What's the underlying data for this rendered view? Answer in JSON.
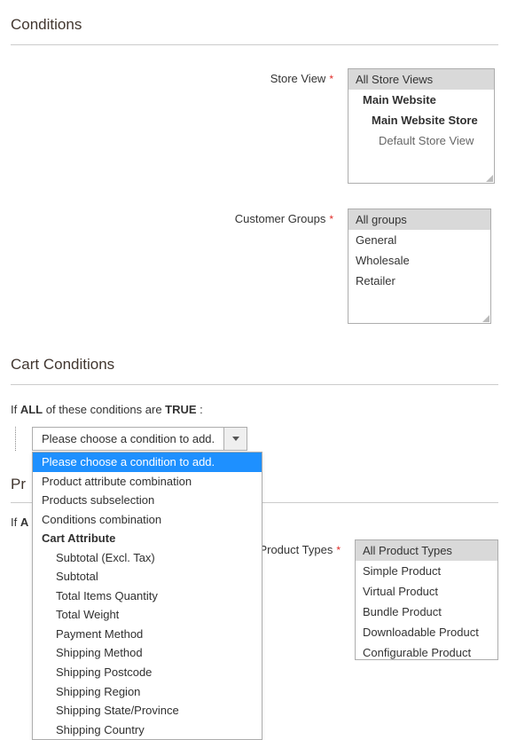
{
  "sections": {
    "conditions_title": "Conditions",
    "cart_conditions_title": "Cart Conditions",
    "product_section_prefix": "Pr",
    "truncated_if": "If A"
  },
  "fields": {
    "store_view": {
      "label": "Store View",
      "options": [
        {
          "text": "All Store Views",
          "level": 0,
          "selected": true
        },
        {
          "text": "Main Website",
          "level": 1,
          "selected": false
        },
        {
          "text": "Main Website Store",
          "level": 2,
          "selected": false
        },
        {
          "text": "Default Store View",
          "level": 3,
          "selected": false
        }
      ]
    },
    "customer_groups": {
      "label": "Customer Groups",
      "options": [
        {
          "text": "All groups",
          "selected": true
        },
        {
          "text": "General",
          "selected": false
        },
        {
          "text": "Wholesale",
          "selected": false
        },
        {
          "text": "Retailer",
          "selected": false
        }
      ]
    },
    "product_types": {
      "label": "Product Types",
      "options": [
        {
          "text": "All Product Types",
          "selected": true
        },
        {
          "text": "Simple Product",
          "selected": false
        },
        {
          "text": "Virtual Product",
          "selected": false
        },
        {
          "text": "Bundle Product",
          "selected": false
        },
        {
          "text": "Downloadable Product",
          "selected": false
        },
        {
          "text": "Configurable Product",
          "selected": false
        }
      ]
    }
  },
  "condition_sentence": {
    "prefix": "If ",
    "aggregator": "ALL",
    "mid": "  of these conditions are ",
    "value": "TRUE",
    "suffix": " :"
  },
  "condition_chooser": {
    "current": "Please choose a condition to add.",
    "options": [
      {
        "text": "Please choose a condition to add.",
        "highlighted": true
      },
      {
        "text": "Product attribute combination"
      },
      {
        "text": "Products subselection"
      },
      {
        "text": "Conditions combination"
      },
      {
        "text": "Cart Attribute",
        "group": true
      },
      {
        "text": "Subtotal (Excl. Tax)",
        "indent": true
      },
      {
        "text": "Subtotal",
        "indent": true
      },
      {
        "text": "Total Items Quantity",
        "indent": true
      },
      {
        "text": "Total Weight",
        "indent": true
      },
      {
        "text": "Payment Method",
        "indent": true
      },
      {
        "text": "Shipping Method",
        "indent": true
      },
      {
        "text": "Shipping Postcode",
        "indent": true
      },
      {
        "text": "Shipping Region",
        "indent": true
      },
      {
        "text": "Shipping State/Province",
        "indent": true
      },
      {
        "text": "Shipping Country",
        "indent": true
      }
    ]
  }
}
